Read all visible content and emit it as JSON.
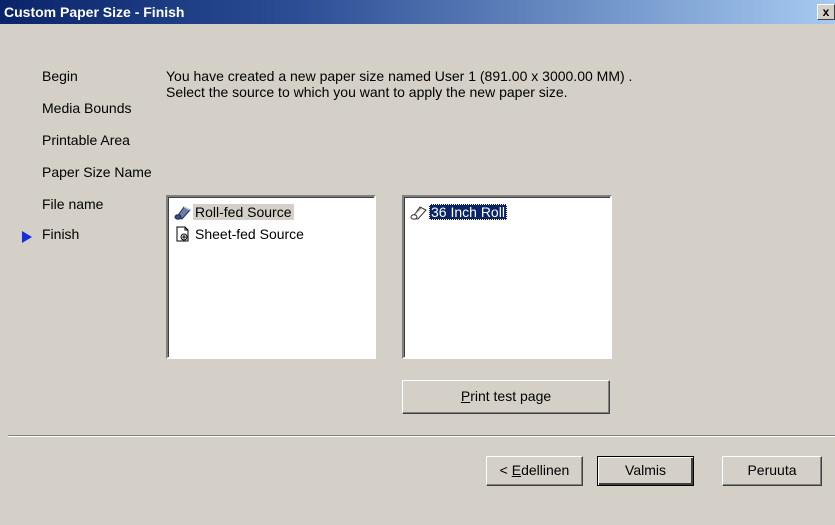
{
  "window": {
    "title": "Custom Paper Size - Finish",
    "close_label": "x"
  },
  "steps": [
    {
      "label": "Begin"
    },
    {
      "label": "Media Bounds"
    },
    {
      "label": "Printable Area"
    },
    {
      "label": "Paper Size Name"
    },
    {
      "label": "File name"
    },
    {
      "label": "Finish",
      "current": true
    }
  ],
  "description": "You have created a new paper size named User 1 (891.00 x 3000.00 MM) . Select the source to which you want to apply the new paper size.",
  "sources": [
    {
      "label": "Roll-fed Source",
      "icon": "roll-icon",
      "selected": true
    },
    {
      "label": "Sheet-fed Source",
      "icon": "sheet-icon"
    }
  ],
  "rolls": [
    {
      "label": "36 Inch Roll",
      "icon": "roll-outline-icon",
      "selected": true
    }
  ],
  "buttons": {
    "print_test_page": {
      "mnemonic": "P",
      "rest": "rint test page"
    },
    "back": {
      "prefix": "< ",
      "mnemonic": "E",
      "rest": "dellinen"
    },
    "finish": "Valmis",
    "cancel": "Peruuta"
  },
  "colors": {
    "title_bar_start": "#0a246a",
    "title_bar_end": "#a6caf0",
    "selection": "#0a246a",
    "step_arrow": "#1a2fd0",
    "dialog_face": "#d4d0c8"
  }
}
